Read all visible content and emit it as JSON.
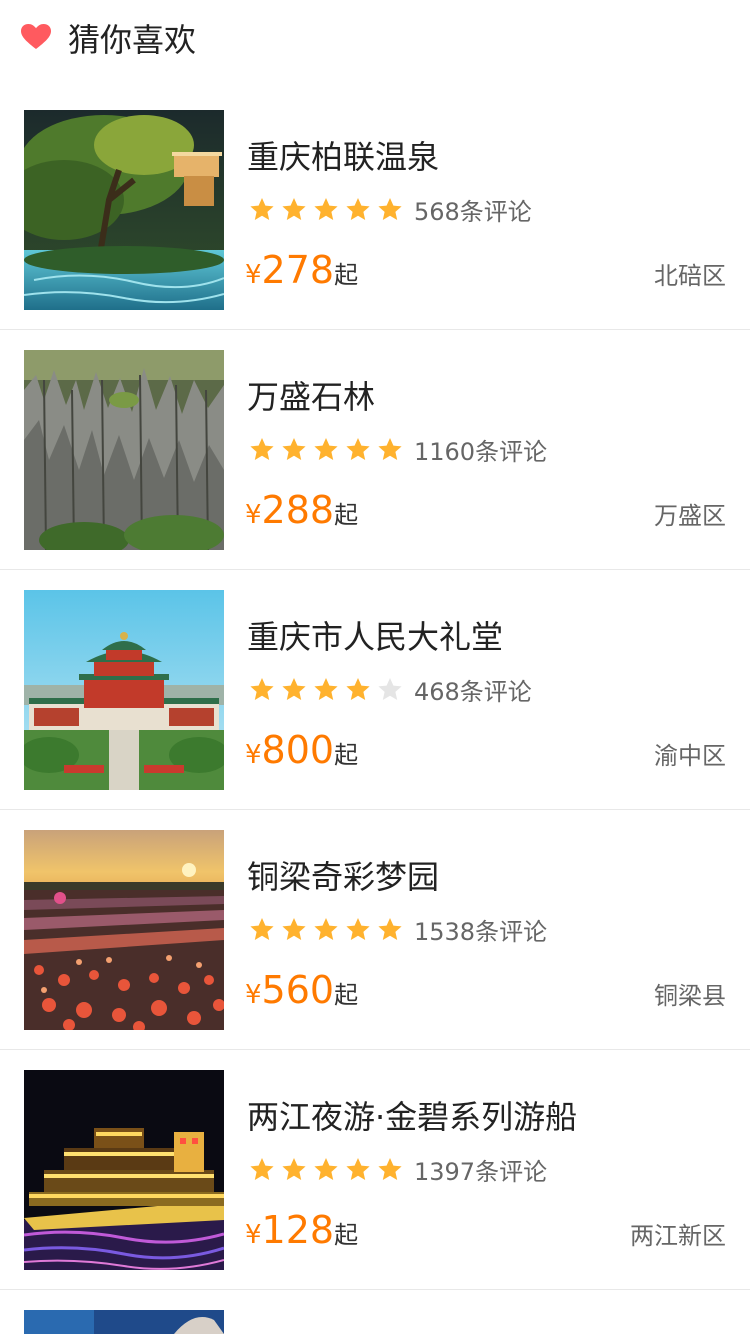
{
  "header": {
    "title": "猜你喜欢",
    "icon": "heart-icon",
    "icon_color": "#ff5a5f"
  },
  "colors": {
    "price": "#ff7a00",
    "star_on": "#ffb22e",
    "star_off": "#e5e5e5"
  },
  "items": [
    {
      "name": "重庆柏联温泉",
      "rating": 5,
      "reviews": "568条评论",
      "currency": "¥",
      "price": "278",
      "price_suffix": "起",
      "district": "北碚区"
    },
    {
      "name": "万盛石林",
      "rating": 5,
      "reviews": "1160条评论",
      "currency": "¥",
      "price": "288",
      "price_suffix": "起",
      "district": "万盛区"
    },
    {
      "name": "重庆市人民大礼堂",
      "rating": 4,
      "reviews": "468条评论",
      "currency": "¥",
      "price": "800",
      "price_suffix": "起",
      "district": "渝中区"
    },
    {
      "name": "铜梁奇彩梦园",
      "rating": 5,
      "reviews": "1538条评论",
      "currency": "¥",
      "price": "560",
      "price_suffix": "起",
      "district": "铜梁县"
    },
    {
      "name": "两江夜游·金碧系列游船",
      "rating": 5,
      "reviews": "1397条评论",
      "currency": "¥",
      "price": "128",
      "price_suffix": "起",
      "district": "两江新区"
    }
  ]
}
